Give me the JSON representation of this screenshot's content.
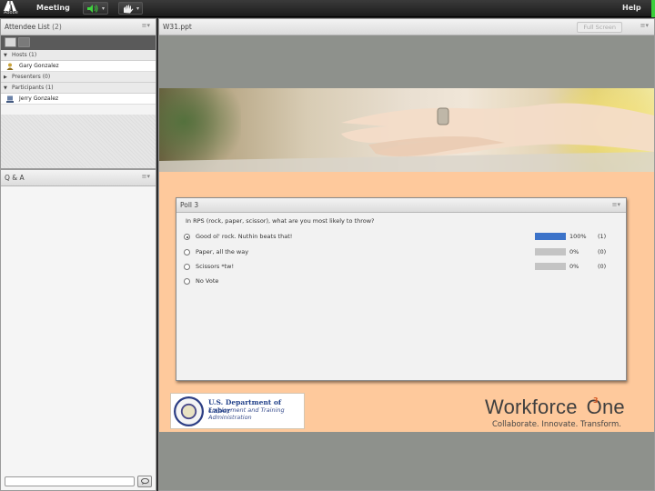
{
  "menubar": {
    "logo_text": "Adobe",
    "meeting_label": "Meeting",
    "help_label": "Help"
  },
  "attendee_pod": {
    "title": "Attendee List",
    "count": "(2)",
    "sections": [
      {
        "label": "Hosts (1)",
        "people": [
          "Gary Gonzalez"
        ]
      },
      {
        "label": "Presenters (0)",
        "people": []
      },
      {
        "label": "Participants (1)",
        "people": [
          "Jerry Gonzalez"
        ]
      }
    ]
  },
  "qa_pod": {
    "title": "Q & A",
    "input_value": ""
  },
  "share_pod": {
    "title": "W31.ppt",
    "full_screen_label": "Full Screen"
  },
  "poll": {
    "title": "Poll 3",
    "question": "In RPS (rock, paper, scissor), what are you most likely to throw?",
    "options": [
      {
        "text": "Good ol' rock.  Nuthin beats that!",
        "percent": "100%",
        "count": "(1)",
        "fraction": 1.0,
        "selected": true
      },
      {
        "text": "Paper, all the way",
        "percent": "0%",
        "count": "(0)",
        "fraction": 0,
        "selected": false
      },
      {
        "text": "Scissors *tw!",
        "percent": "0%",
        "count": "(0)",
        "fraction": 0,
        "selected": false
      },
      {
        "text": "No Vote",
        "selected": false
      }
    ],
    "bar_color": "#3c73c9"
  },
  "slide": {
    "dol_line1": "U.S. Department of Labor",
    "dol_line2": "Employment and Training",
    "dol_line3": "Administration",
    "workforce_name": "Workforce",
    "workforce_sup": "3",
    "workforce_one": "One",
    "workforce_tagline": "Collaborate.  Innovate.  Transform.",
    "accent_color": "#fec99c"
  }
}
